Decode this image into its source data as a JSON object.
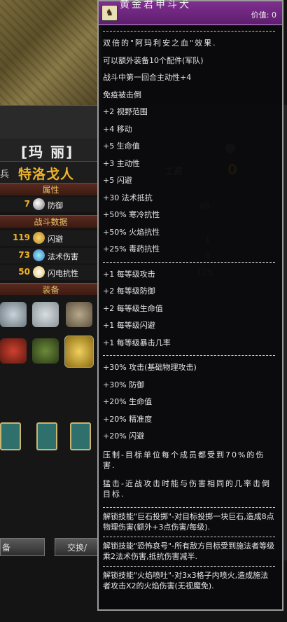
{
  "background": {
    "character_name": "[玛 丽]",
    "title_left": "兵",
    "title_main": "特洛戈人",
    "section_attributes": "属性",
    "attr_rows": [
      {
        "value": "7",
        "label": "防御"
      }
    ],
    "section_combat": "战斗数据",
    "combat_rows": [
      {
        "value": "119",
        "label": "闪避"
      },
      {
        "value": "73",
        "label": "法术伤害"
      },
      {
        "value": "50",
        "label": "闪电抗性"
      }
    ],
    "section_equip": "装备",
    "wage_label": "工资",
    "wage_value": "0",
    "right_numbers": [
      "40",
      "1",
      "0",
      "125"
    ],
    "button_left": "备",
    "button_right": "交换/"
  },
  "tooltip": {
    "item_icon": "horse-icon",
    "item_name": "黄金君甲斗犬",
    "price": "价值: 0",
    "intro": "双倍的\"阿玛利安之血\"效果.",
    "group1": [
      "可以额外装备10个配件(军队)",
      "战斗中第一回合主动性+4",
      "免疫被击倒",
      "+2 视野范围",
      "+4 移动",
      "+5 生命值",
      "+3 主动性",
      "+5 闪避",
      "+30 法术抵抗",
      "+50% 寒冷抗性",
      "+50% 火焰抗性",
      "+25% 毒药抗性"
    ],
    "group2": [
      "+1 每等级攻击",
      "+2 每等级防御",
      "+2 每等级生命值",
      "+1 每等级闪避",
      "+1 每等级暴击几率"
    ],
    "group3": [
      "+30% 攻击(基础物理攻击)",
      "+30% 防御",
      "+20% 生命值",
      "+20% 精准度",
      "+20% 闪避"
    ],
    "ability_suppress": "压制-目标单位每个成员都受到70%的伤害.",
    "ability_charge": "猛击-近战攻击时能与伤害相同的几率击倒目标.",
    "unlock1": "解锁技能\"巨石投掷\"-对目标投掷一块巨石,造成8点物理伤害(额外+3点伤害/每级).",
    "unlock2": "解锁技能\"恐怖哀号\"-所有敌方目标受到施法者等级乘2法术伤害,抵抗伤害减半.",
    "unlock3": "解锁技能\"火焰喷吐\"-对3x3格子内喷火,造成施法者攻击X2的火焰伤害(无视魔免)."
  },
  "colors": {
    "accent_gold": "#f0b428",
    "tooltip_header": "#6e2580"
  }
}
